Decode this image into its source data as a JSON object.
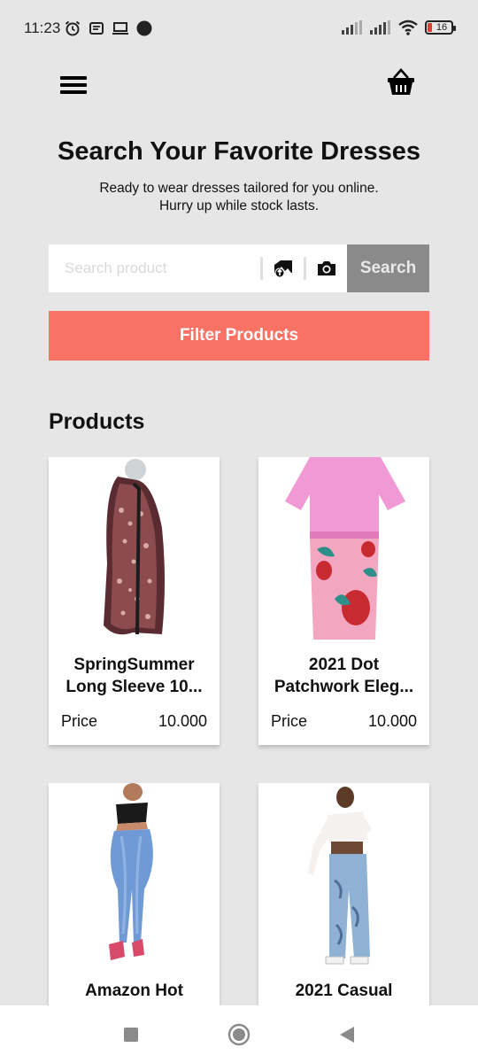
{
  "status_bar": {
    "time": "11:23",
    "battery": "16",
    "icons": [
      "alarm-icon",
      "notification-icon",
      "laptop-icon",
      "dot-icon",
      "signal-icon",
      "signal-icon",
      "wifi-icon",
      "battery-icon"
    ]
  },
  "header": {
    "menu_icon": "hamburger-menu-icon",
    "cart_icon": "shopping-basket-icon"
  },
  "hero": {
    "title": "Search Your Favorite Dresses",
    "subtitle_line1": "Ready to wear dresses tailored for you online.",
    "subtitle_line2": "Hurry up while stock lasts."
  },
  "search": {
    "placeholder": "Search product",
    "value": "",
    "upload_icon": "image-upload-icon",
    "camera_icon": "camera-icon",
    "button_label": "Search"
  },
  "filter": {
    "button_label": "Filter Products"
  },
  "products_section": {
    "title": "Products",
    "items": [
      {
        "name_line1": "SpringSummer",
        "name_line2": "Long Sleeve 10...",
        "price_label": "Price",
        "price": "10.000"
      },
      {
        "name_line1": "2021 Dot",
        "name_line2": "Patchwork Eleg...",
        "price_label": "Price",
        "price": "10.000"
      },
      {
        "name_line1": "Amazon Hot",
        "name_line2": "",
        "price_label": "",
        "price": ""
      },
      {
        "name_line1": "2021 Casual",
        "name_line2": "",
        "price_label": "",
        "price": ""
      }
    ]
  },
  "nav_bar": {
    "icons": [
      "recents-square-icon",
      "home-circle-icon",
      "back-triangle-icon"
    ]
  },
  "colors": {
    "background": "#e6e6e6",
    "filter_button": "#f97264",
    "search_button": "#8a8a8a"
  }
}
